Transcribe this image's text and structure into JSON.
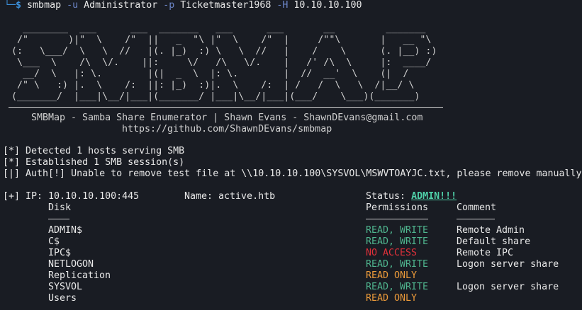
{
  "prompt": {
    "corner": "└─",
    "symbol": "$",
    "program": "smbmap",
    "flag_user": "-u",
    "user": "Administrator",
    "flag_pass": "-p",
    "password": "Ticketmaster1968",
    "flag_host": "-H",
    "host": "10.10.10.100"
  },
  "banner": {
    "art": [
      "    ________  ___      ___  _______   ___      ___       __         _______",
      "   /\"       )|\"  \\    /\"  ||   _  \"\\ |\"  \\    /\"  |     /\"\"\\       |   __ \"\\",
      "  (:   \\___/  \\   \\  //   |(. |_)  :) \\   \\  //   |    /    \\      (. |__) :)",
      "   \\___  \\    /\\  \\/.    ||:     \\/   /\\   \\/.    |   /' /\\  \\     |:  ____/",
      "    __/  \\   |: \\.        |(|  _  \\  |: \\.        |  //  __'  \\    (|  /",
      "   /\" \\   :) |.  \\    /:  ||: |_)  :)|.  \\    /:  | /   /  \\   \\  /|__/ \\",
      "  (_______/  |___|\\__/|___|(_______/ |___|\\__/|___|(___/    \\___)(_______)"
    ],
    "tagline": "SMBMap - Samba Share Enumerator | Shawn Evans - ShawnDEvans@gmail.com",
    "url": "https://github.com/ShawnDEvans/smbmap"
  },
  "messages": [
    "[*] Detected 1 hosts serving SMB",
    "[*] Established 1 SMB session(s)",
    "[|] Auth[!] Unable to remove test file at \\\\10.10.10.100\\SYSVOL\\MSWVTOAYJC.txt, please remove manually"
  ],
  "result": {
    "ip_label": "[+] IP: 10.10.10.100:445",
    "name_label": "Name: active.htb",
    "status_label": "Status:",
    "status_value": "ADMIN!!!",
    "headers": {
      "disk": "Disk",
      "permissions": "Permissions",
      "comment": "Comment"
    },
    "shares": [
      {
        "disk": "ADMIN$",
        "permissions": "READ, WRITE",
        "perm_level": "rw",
        "comment": "Remote Admin"
      },
      {
        "disk": "C$",
        "permissions": "READ, WRITE",
        "perm_level": "rw",
        "comment": "Default share"
      },
      {
        "disk": "IPC$",
        "permissions": "NO ACCESS",
        "perm_level": "none",
        "comment": "Remote IPC"
      },
      {
        "disk": "NETLOGON",
        "permissions": "READ, WRITE",
        "perm_level": "rw",
        "comment": "Logon server share"
      },
      {
        "disk": "Replication",
        "permissions": "READ ONLY",
        "perm_level": "ro",
        "comment": ""
      },
      {
        "disk": "SYSVOL",
        "permissions": "READ, WRITE",
        "perm_level": "rw",
        "comment": "Logon server share"
      },
      {
        "disk": "Users",
        "permissions": "READ ONLY",
        "perm_level": "ro",
        "comment": ""
      }
    ]
  },
  "colors": {
    "background": "#191c23",
    "prompt": "#3b8ed8",
    "read_write": "#4fb48e",
    "no_access": "#e0303a",
    "read_only": "#eb9a3a",
    "admin_status": "#4fd0a8"
  }
}
